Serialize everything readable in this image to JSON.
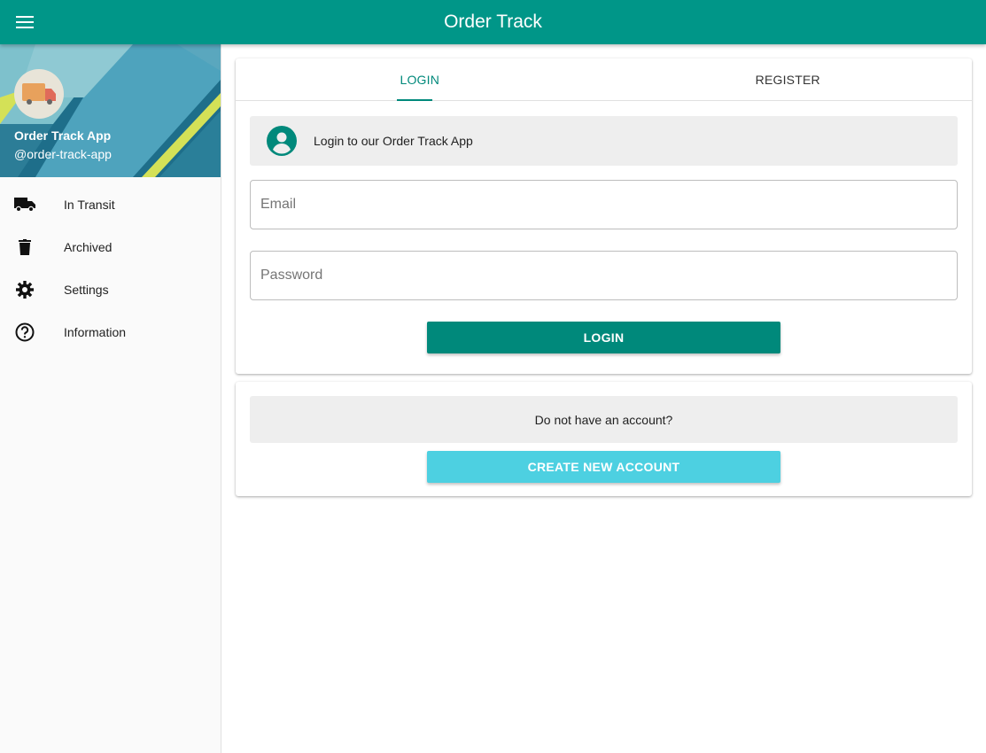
{
  "app_bar": {
    "title": "Order Track",
    "menu_icon": "menu-icon",
    "color": "#009688"
  },
  "drawer": {
    "app_name": "Order Track App",
    "handle": "@order-track-app",
    "avatar_icon": "truck-icon",
    "items": [
      {
        "label": "In Transit",
        "icon": "truck-icon"
      },
      {
        "label": "Archived",
        "icon": "trash-icon"
      },
      {
        "label": "Settings",
        "icon": "gear-icon"
      },
      {
        "label": "Information",
        "icon": "help-circle-icon"
      }
    ]
  },
  "auth": {
    "tabs": [
      {
        "label": "LOGIN",
        "active": true
      },
      {
        "label": "REGISTER",
        "active": false
      }
    ],
    "info_text": "Login to our Order Track App",
    "email_placeholder": "Email",
    "email_value": "",
    "password_placeholder": "Password",
    "password_value": "",
    "login_button": "LOGIN",
    "accent": "#00897b"
  },
  "register": {
    "prompt": "Do not have an account?",
    "create_button": "CREATE NEW ACCOUNT",
    "button_color": "#4dd0e1"
  }
}
